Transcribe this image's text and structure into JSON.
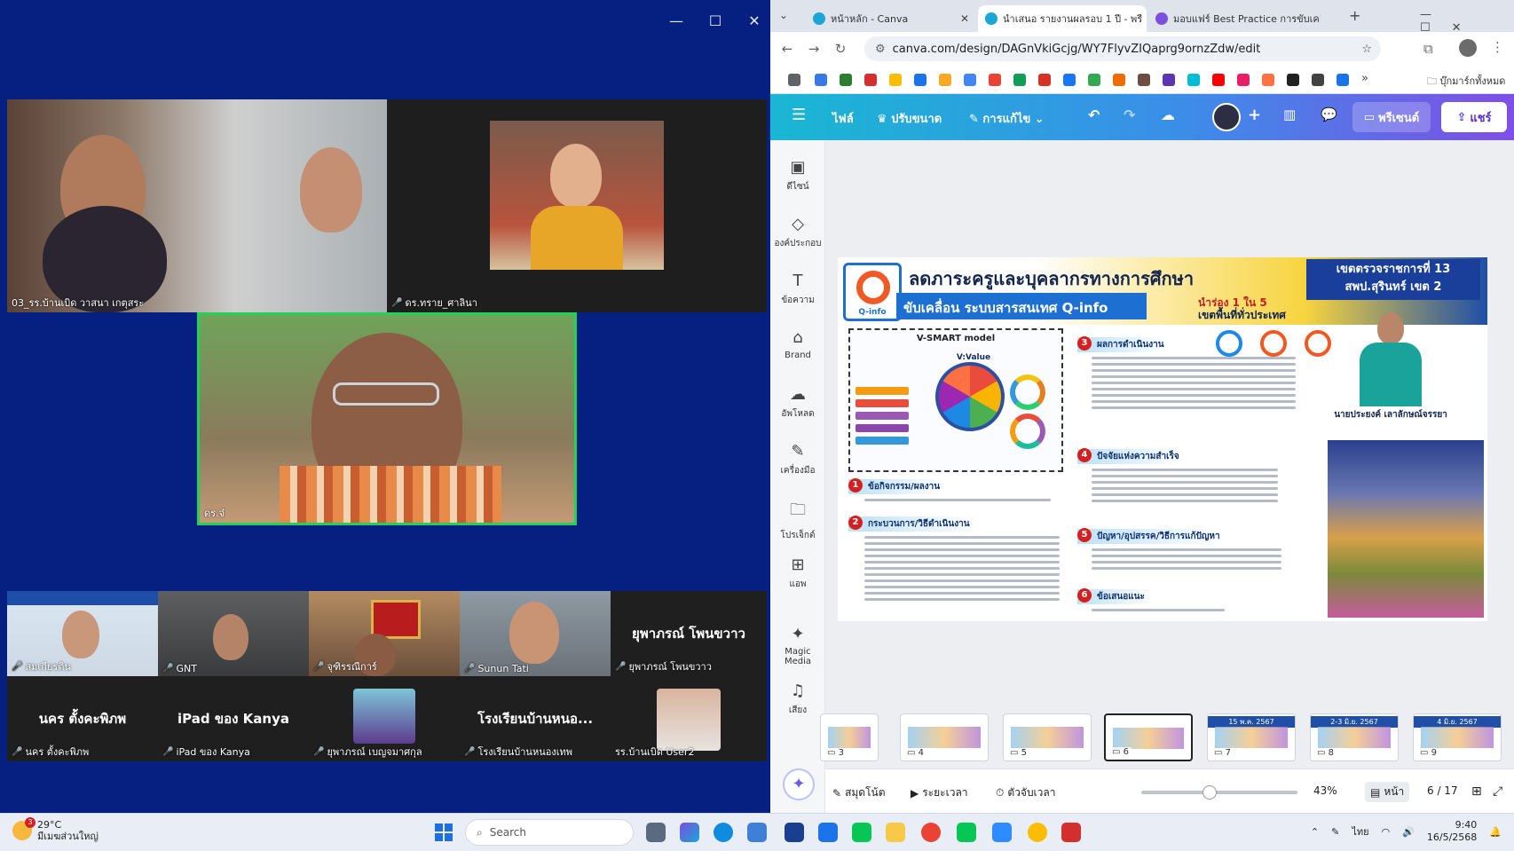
{
  "zoom": {
    "window_controls": [
      "—",
      "☐",
      "✕"
    ],
    "tiles_main": [
      {
        "label": "03_รร.บ้านเบิด วาสนา เกตุสระ",
        "muted": false
      },
      {
        "label": "ดร.ทราย_ศาลินา",
        "muted": true
      },
      {
        "label": "ดร.จ๋",
        "muted": false
      }
    ],
    "tiles_row1": [
      {
        "label": "สมเกียรติน",
        "muted": true
      },
      {
        "label": "GNT",
        "muted": true
      },
      {
        "label": "จุฑิรรณีการ์",
        "muted": true
      },
      {
        "label": "Sunun Tati",
        "muted": true
      },
      {
        "label": "ยุพาภรณ์ โพนขวาว",
        "big": "ยุพาภรณ์ โพนขวาว",
        "muted": true
      }
    ],
    "tiles_row2": [
      {
        "label": "นคร ตั้งคะพิภพ",
        "big": "นคร ตั้งคะพิภพ",
        "muted": true
      },
      {
        "label": "iPad ของ Kanya",
        "big": "iPad ของ Kanya",
        "muted": true
      },
      {
        "label": "ยุพาภรณ์ เบญจมาศกุล",
        "muted": true
      },
      {
        "label": "โรงเรียนบ้านหนองเทพ",
        "big": "โรงเรียนบ้านหนอ...",
        "muted": true
      },
      {
        "label": "รร.บ้านเบิด User2",
        "muted": false
      }
    ]
  },
  "chrome": {
    "tabs": [
      {
        "title": "หน้าหลัก - Canva"
      },
      {
        "title": "นำเสนอ รายงานผลรอบ 1 ปี - พรี"
      },
      {
        "title": "มอบแฟร์ Best Practice การขับเคลื่"
      }
    ],
    "url": "canva.com/design/DAGnVkiGcjg/WY7FlyvZIQaprg9ornzZdw/edit",
    "bookmarks_label": "บุ๊กมาร์กทั้งหมด"
  },
  "canva": {
    "toolbar": {
      "file": "ไฟล์",
      "resize": "ปรับขนาด",
      "edit": "การแก้ไข",
      "present": "พรีเซนต์",
      "share": "แชร์"
    },
    "rail": [
      "ดีไซน์",
      "องค์ประกอบ",
      "ข้อความ",
      "Brand",
      "อัพโหลด",
      "เครื่องมือ",
      "โปรเจ็กต์",
      "แอพ",
      "Magic Media",
      "เสียง"
    ],
    "slide": {
      "title": "ลดภาระครูและบุคลากรทางการศึกษา",
      "subtitle": "ขับเคลื่อน ระบบสารสนเทศ Q-info",
      "tag_line1": "นำร่อง 1 ใน 5",
      "tag_line2": "เขตพื้นที่ทั่วประเทศ",
      "region_line1": "เขตตรวจราชการที่ 13",
      "region_line2": "สพป.สุรินทร์ เขต 2",
      "logo_label": "Q-info",
      "model_title": "V-SMART model",
      "wheel_label": "V:Value",
      "sections": [
        {
          "n": "1",
          "label": "ข้อกิจกรรม/ผลงาน"
        },
        {
          "n": "2",
          "label": "กระบวนการ/วิธีดำเนินงาน"
        },
        {
          "n": "3",
          "label": "ผลการดำเนินงาน"
        },
        {
          "n": "4",
          "label": "ปัจจัยแห่งความสำเร็จ"
        },
        {
          "n": "5",
          "label": "ปัญหา/อุปสรรค/วิธีการแก้ปัญหา"
        },
        {
          "n": "6",
          "label": "ข้อเสนอแนะ"
        }
      ],
      "person_name": "นายประยงค์ เลาลักษณ์จรรยา"
    },
    "thumbnails": [
      {
        "num": "3",
        "date": ""
      },
      {
        "num": "4",
        "date": ""
      },
      {
        "num": "5",
        "date": ""
      },
      {
        "num": "6",
        "date": "",
        "active": true
      },
      {
        "num": "7",
        "date": "15 พ.ค. 2567"
      },
      {
        "num": "8",
        "date": "2-3 มิ.ย. 2567"
      },
      {
        "num": "9",
        "date": "4 มิ.ย. 2567"
      }
    ],
    "bottom": {
      "notes": "สมุดโน้ต",
      "duration": "ระยะเวลา",
      "timer": "ตัวจับเวลา",
      "zoom": "43%",
      "pages_label": "หน้า",
      "page_counter": "6 / 17",
      "zoom_fraction": 0.43
    }
  },
  "taskbar": {
    "weather_temp": "29°C",
    "weather_desc": "มีเมฆส่วนใหญ่",
    "weather_badge": "3",
    "search": "Search",
    "lang": "ไทย",
    "time": "9:40",
    "date": "16/5/2568"
  }
}
